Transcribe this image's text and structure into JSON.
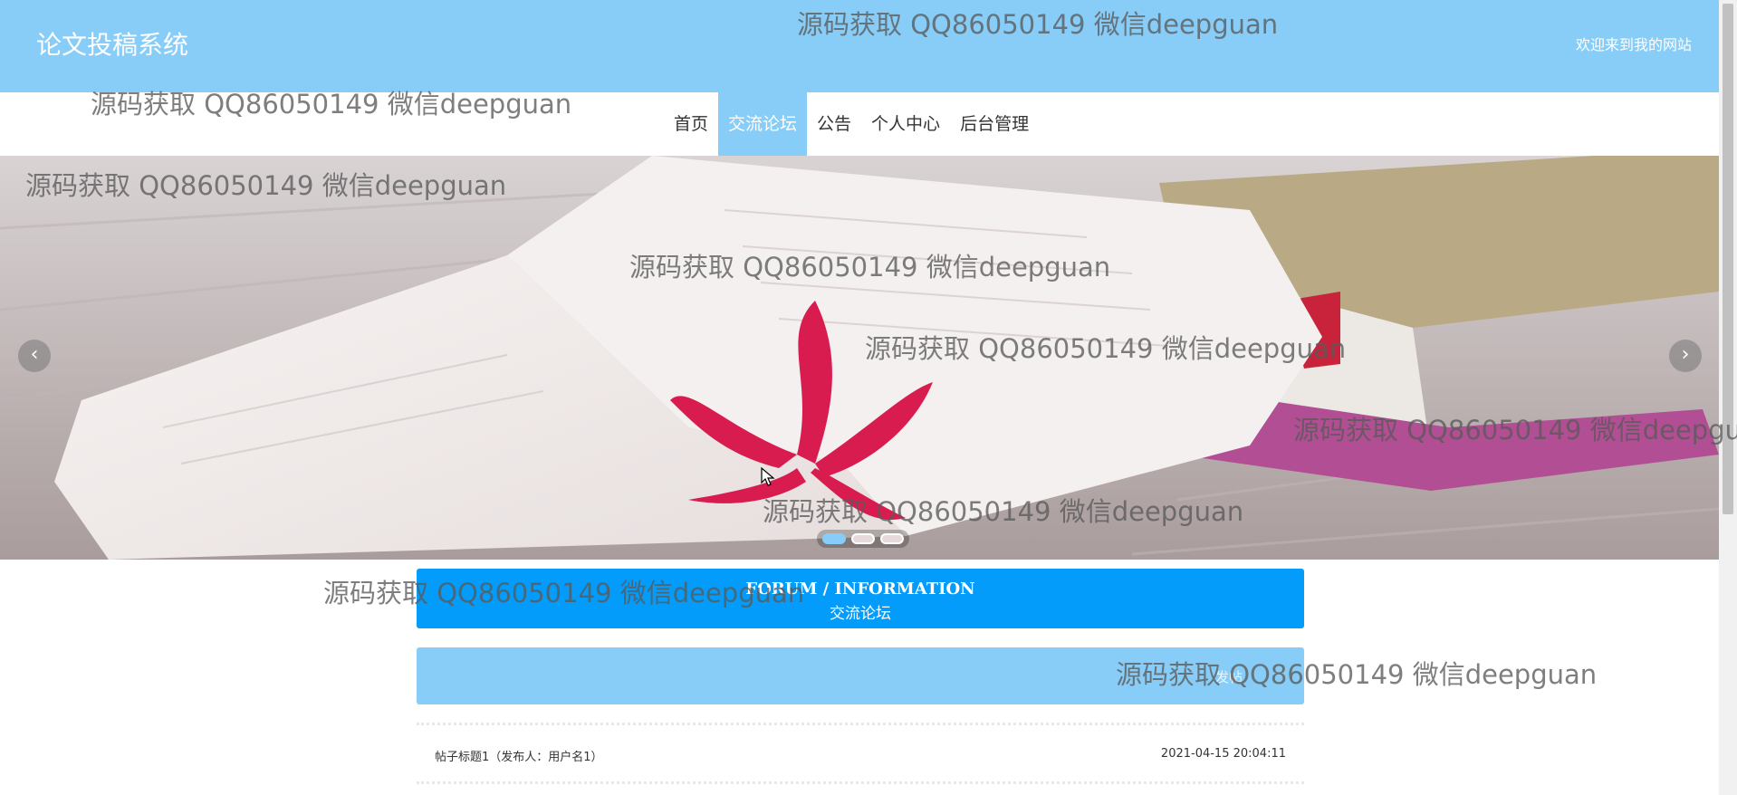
{
  "header": {
    "site_title": "论文投稿系统",
    "welcome_text": "欢迎来到我的网站"
  },
  "nav": {
    "items": [
      {
        "label": "首页"
      },
      {
        "label": "交流论坛"
      },
      {
        "label": "公告"
      },
      {
        "label": "个人中心"
      },
      {
        "label": "后台管理"
      }
    ],
    "active_index": 1
  },
  "carousel": {
    "prev_label": "‹",
    "next_label": "›",
    "slide_count": 3,
    "active_slide": 1
  },
  "forum": {
    "section_en": "FORUM / INFORMATION",
    "section_cn": "交流论坛",
    "post_button": "发帖",
    "posts": [
      {
        "title": "帖子标题1（发布人：用户名1）",
        "time": "2021-04-15 20:04:11"
      }
    ]
  },
  "watermark": "源码获取 QQ86050149 微信deepguan",
  "colors": {
    "header_bg": "#87cdf7",
    "section_header_bg": "#039cfa",
    "active_nav_bg": "#87cdf7"
  }
}
